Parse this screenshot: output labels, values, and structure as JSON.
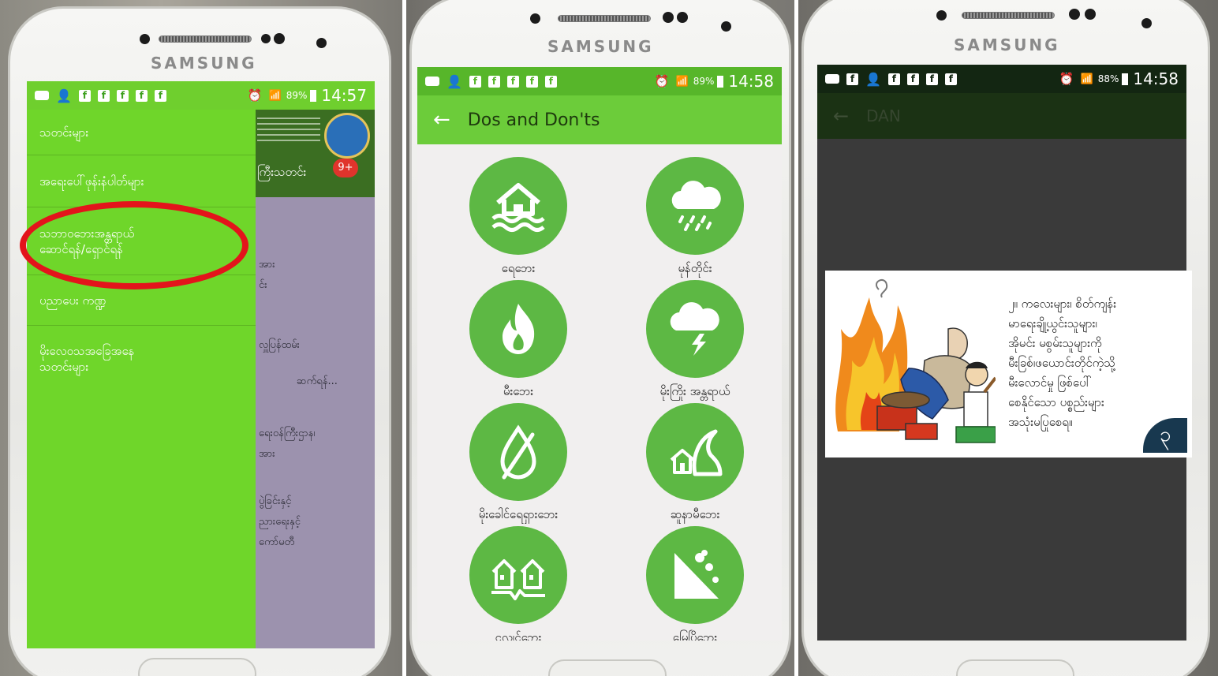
{
  "panel1": {
    "brand": "SAMSUNG",
    "status": {
      "battery": "89%",
      "time": "14:57"
    },
    "drawer_items": [
      {
        "label": "သတင်းများ"
      },
      {
        "label": "အရေးပေါ်ဖုန်းနံပါတ်များ"
      },
      {
        "label_line1": "သဘာဝဘေးအန္တရာယ်",
        "label_line2": "ဆောင်ရန်/ရှောင်ရန်"
      },
      {
        "label": "ပညာပေး ကဏ္ဍ"
      },
      {
        "label_line1": "မိုးလေဝသအခြေအနေ",
        "label_line2": "သတင်းများ"
      }
    ],
    "behind": {
      "badge": "9+",
      "header_text": "ကြီးသတင်း",
      "lines": [
        "အား",
        "င်း",
        "လှူပြန်ထမ်း",
        "ဆက်ရန်...",
        "ရေးဝန်ကြီးဌာန၊",
        "အား",
        "ပွဲခြင်းနှင့်",
        "ညားရေးနှင့်",
        "ကော်မတီ"
      ]
    }
  },
  "panel2": {
    "brand": "SAMSUNG",
    "status": {
      "battery": "89%",
      "time": "14:58"
    },
    "title": "Dos and Don'ts",
    "tiles": [
      {
        "label": "ရေဘေး",
        "icon": "flood-icon"
      },
      {
        "label": "မုန်တိုင်း",
        "icon": "storm-icon"
      },
      {
        "label": "မီးဘေး",
        "icon": "fire-icon"
      },
      {
        "label": "မိုးကြိုး အန္တရာယ်",
        "icon": "lightning-icon"
      },
      {
        "label": "မိုးခေါင်ရေရှားဘေး",
        "icon": "drought-icon"
      },
      {
        "label": "ဆူနာမီဘေး",
        "icon": "tsunami-icon"
      },
      {
        "label": "ငလျင်ဘေး",
        "icon": "earthquake-icon"
      },
      {
        "label": "မြေပြိုဘေး",
        "icon": "landslide-icon"
      }
    ]
  },
  "panel3": {
    "brand": "SAMSUNG",
    "status": {
      "battery": "88%",
      "time": "14:58"
    },
    "title": "DAN",
    "caption": "၂။ ကလေးများ၊ စိတ်ကျန်း\nမာရေးချို့ယွင်းသူများ၊\nအိုမင်း မစွမ်းသူများကို\nမီးခြစ်၊ဖယောင်းတိုင်ကဲ့သို့\nမီးလောင်မှု ဖြစ်ပေါ်\nစေနိုင်သော ပစ္စည်းများ\nအသုံးမပြုစေရ။",
    "page_badge": "၃"
  }
}
